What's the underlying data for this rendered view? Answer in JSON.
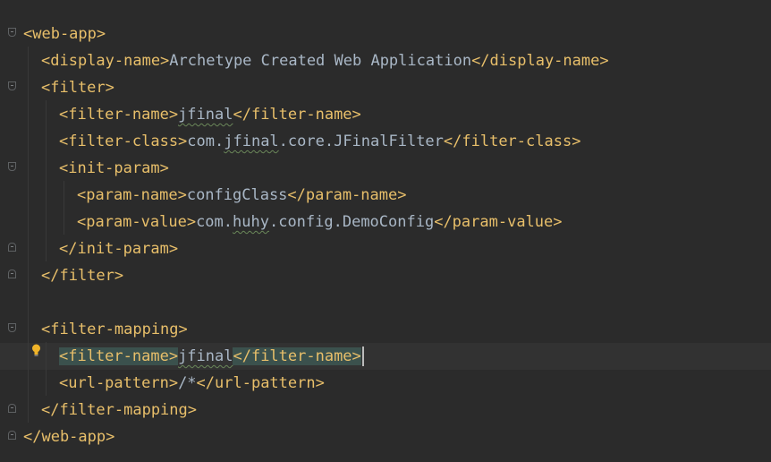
{
  "editor": {
    "lines": [
      {
        "indent": 0,
        "parts": [
          {
            "t": "tag",
            "v": "<web-app>"
          }
        ]
      },
      {
        "indent": 1,
        "parts": [
          {
            "t": "tag",
            "v": "<display-name>"
          },
          {
            "t": "txt",
            "v": "Archetype Created Web Application"
          },
          {
            "t": "tag",
            "v": "</display-name>"
          }
        ]
      },
      {
        "indent": 1,
        "parts": [
          {
            "t": "tag",
            "v": "<filter>"
          }
        ]
      },
      {
        "indent": 2,
        "parts": [
          {
            "t": "tag",
            "v": "<filter-name>"
          },
          {
            "t": "txt",
            "v": "jfinal",
            "sq": true
          },
          {
            "t": "tag",
            "v": "</filter-name>"
          }
        ]
      },
      {
        "indent": 2,
        "parts": [
          {
            "t": "tag",
            "v": "<filter-class>"
          },
          {
            "t": "txt",
            "v": "com."
          },
          {
            "t": "txt",
            "v": "jfinal",
            "sq": true
          },
          {
            "t": "txt",
            "v": ".core.JFinalFilter"
          },
          {
            "t": "tag",
            "v": "</filter-class>"
          }
        ]
      },
      {
        "indent": 2,
        "parts": [
          {
            "t": "tag",
            "v": "<init-param>"
          }
        ]
      },
      {
        "indent": 3,
        "parts": [
          {
            "t": "tag",
            "v": "<param-name>"
          },
          {
            "t": "txt",
            "v": "configClass"
          },
          {
            "t": "tag",
            "v": "</param-name>"
          }
        ]
      },
      {
        "indent": 3,
        "parts": [
          {
            "t": "tag",
            "v": "<param-value>"
          },
          {
            "t": "txt",
            "v": "com."
          },
          {
            "t": "txt",
            "v": "huhy",
            "sq": true
          },
          {
            "t": "txt",
            "v": ".config.DemoConfig"
          },
          {
            "t": "tag",
            "v": "</param-value>"
          }
        ]
      },
      {
        "indent": 2,
        "parts": [
          {
            "t": "tag",
            "v": "</init-param>"
          }
        ]
      },
      {
        "indent": 1,
        "parts": [
          {
            "t": "tag",
            "v": "</filter>"
          }
        ]
      },
      {
        "indent": 0,
        "parts": []
      },
      {
        "indent": 1,
        "parts": [
          {
            "t": "tag",
            "v": "<filter-mapping>"
          }
        ]
      },
      {
        "indent": 2,
        "current": true,
        "parts": [
          {
            "t": "tag",
            "v": "<filter-name>",
            "hl": true
          },
          {
            "t": "txt",
            "v": "jfinal",
            "sq": true
          },
          {
            "t": "tag",
            "v": "</filter-name>",
            "hl": true,
            "caret": true
          }
        ]
      },
      {
        "indent": 2,
        "parts": [
          {
            "t": "tag",
            "v": "<url-pattern>"
          },
          {
            "t": "txt",
            "v": "/*"
          },
          {
            "t": "tag",
            "v": "</url-pattern>"
          }
        ]
      },
      {
        "indent": 1,
        "parts": [
          {
            "t": "tag",
            "v": "</filter-mapping>"
          }
        ]
      },
      {
        "indent": 0,
        "parts": [
          {
            "t": "tag",
            "v": "</web-app>"
          }
        ]
      }
    ],
    "colors": {
      "background": "#2b2b2b",
      "tag": "#e8bf6a",
      "text": "#a9b7c6",
      "current_line": "#323232",
      "match_highlight": "#3b514d"
    },
    "gutter_icons": [
      "fold-open-icon",
      "fold-close-icon",
      "lightbulb-icon"
    ]
  }
}
